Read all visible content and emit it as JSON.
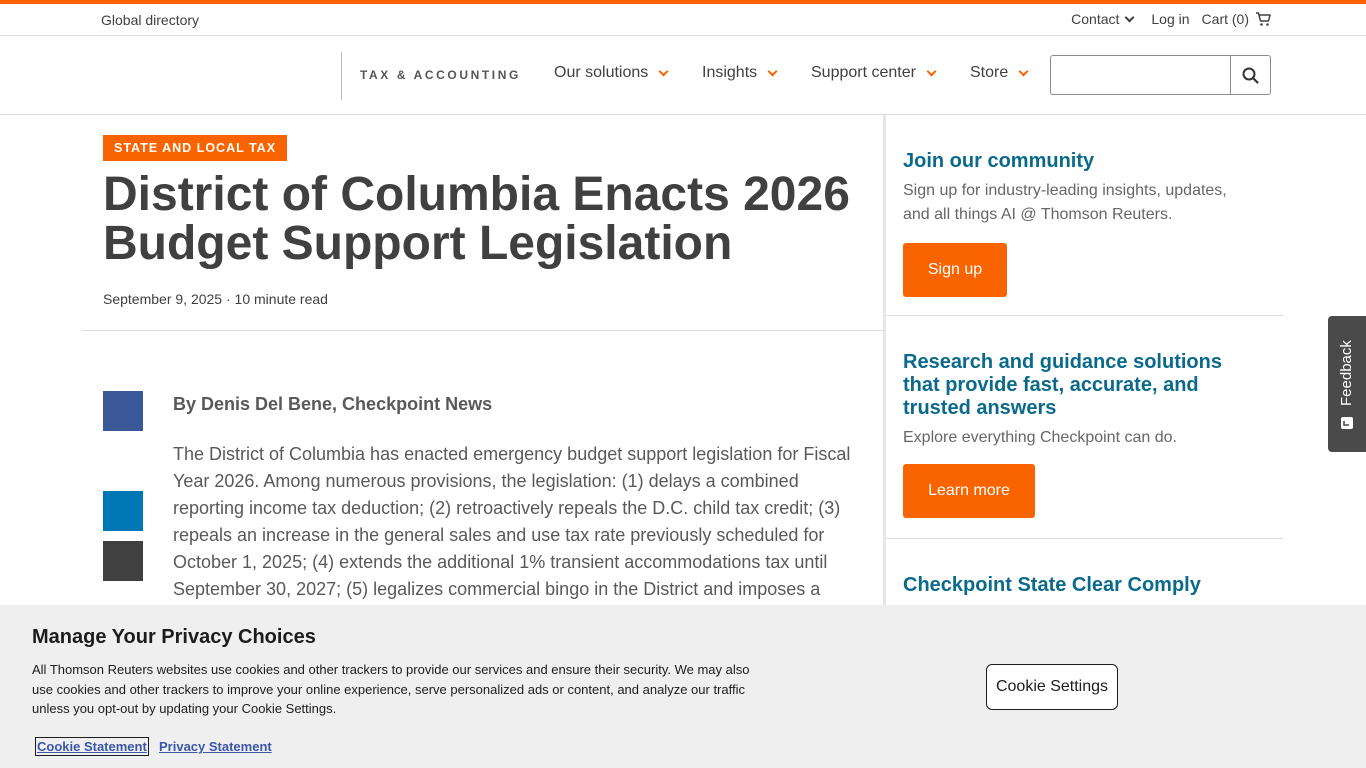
{
  "colors": {
    "accent": "#fa6400",
    "link_teal": "#0a6a8c",
    "facebook": "#3b5998",
    "linkedin": "#0077b5"
  },
  "utility": {
    "global_directory": "Global directory",
    "contact": "Contact",
    "login": "Log in",
    "cart": "Cart (0)"
  },
  "nav": {
    "brand": "TAX & ACCOUNTING",
    "items": [
      {
        "label": "Our solutions"
      },
      {
        "label": "Insights"
      },
      {
        "label": "Support center"
      },
      {
        "label": "Store"
      }
    ],
    "search_placeholder": ""
  },
  "article": {
    "tag": "STATE AND LOCAL TAX",
    "title": "District of Columbia Enacts 2026 Budget Support Legislation",
    "date": "September 9, 2025",
    "separator": "·",
    "read_time": "10 minute read",
    "byline": "By Denis Del Bene, Checkpoint News",
    "body": "The District of Columbia has enacted emergency budget support legislation for Fiscal Year 2026. Among numerous provisions, the legislation: (1) delays a combined reporting income tax deduction; (2) retroactively repeals the D.C. child tax credit; (3) repeals an increase in the general sales and use tax rate previously scheduled for October 1, 2025; (4) extends the additional 1% transient accommodations tax until September 30, 2027; (5) legalizes commercial bingo in the District and imposes a",
    "share_icons": [
      "facebook-icon",
      "linkedin-icon",
      "email-icon"
    ]
  },
  "sidebar": {
    "blocks": [
      {
        "heading": "Join our community",
        "text": "Sign up for industry-leading insights, updates, and all things AI @ Thomson Reuters.",
        "button": "Sign up"
      },
      {
        "heading": "Research and guidance solutions that provide fast, accurate, and trusted answers",
        "text": "Explore everything Checkpoint can do.",
        "button": "Learn more"
      },
      {
        "heading": "Checkpoint State Clear Comply"
      }
    ]
  },
  "feedback": {
    "label": "Feedback"
  },
  "cookie": {
    "title": "Manage Your Privacy Choices",
    "text": "All Thomson Reuters websites use cookies and other trackers to provide our services and ensure their security. We may also use cookies and other trackers to improve your online experience, serve personalized ads or content, and analyze our traffic unless you opt-out by updating your Cookie Settings.",
    "settings_button": "Cookie Settings",
    "cookie_statement": "Cookie Statement",
    "privacy_statement": "Privacy Statement"
  }
}
